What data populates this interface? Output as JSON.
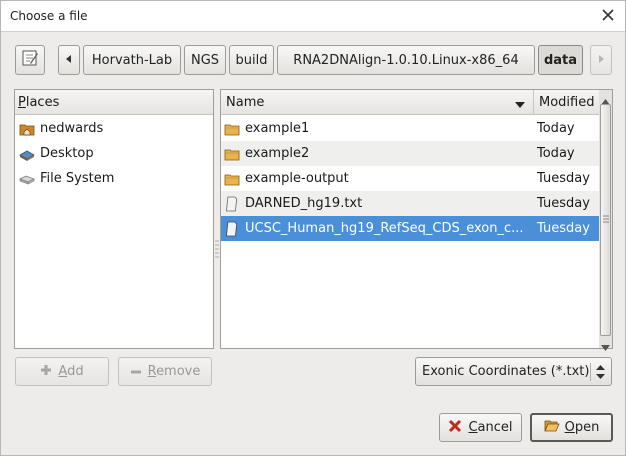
{
  "window": {
    "title": "Choose a file"
  },
  "path_bar": {
    "segments": [
      "Horvath-Lab",
      "NGS",
      "build",
      "RNA2DNAlign-1.0.10.Linux-x86_64",
      "data"
    ],
    "current": "data"
  },
  "places": {
    "header": "Places",
    "header_mnemonic": "P",
    "header_rest": "laces",
    "items": [
      {
        "label": "nedwards",
        "icon": "home-folder-icon"
      },
      {
        "label": "Desktop",
        "icon": "desktop-icon"
      },
      {
        "label": "File System",
        "icon": "drive-icon"
      }
    ],
    "add_label": "Add",
    "add_mnemonic": "A",
    "add_rest": "dd",
    "remove_label": "Remove",
    "remove_mnemonic": "R",
    "remove_rest": "emove"
  },
  "files": {
    "col_name": "Name",
    "col_modified": "Modified",
    "rows": [
      {
        "name": "example1",
        "modified": "Today",
        "icon": "folder-icon",
        "selected": false
      },
      {
        "name": "example2",
        "modified": "Today",
        "icon": "folder-icon",
        "selected": false
      },
      {
        "name": "example-output",
        "modified": "Tuesday",
        "icon": "folder-icon",
        "selected": false
      },
      {
        "name": "DARNED_hg19.txt",
        "modified": "Tuesday",
        "icon": "file-icon",
        "selected": false
      },
      {
        "name": "UCSC_Human_hg19_RefSeq_CDS_exon_c...",
        "modified": "Tuesday",
        "icon": "file-icon",
        "selected": true
      }
    ]
  },
  "filter": {
    "value": "Exonic Coordinates (*.txt)"
  },
  "actions": {
    "cancel_mnemonic": "C",
    "cancel_rest": "ancel",
    "open_mnemonic": "O",
    "open_rest": "pen"
  },
  "colors": {
    "selection": "#4a90d9",
    "accent": "#4a90d9"
  }
}
